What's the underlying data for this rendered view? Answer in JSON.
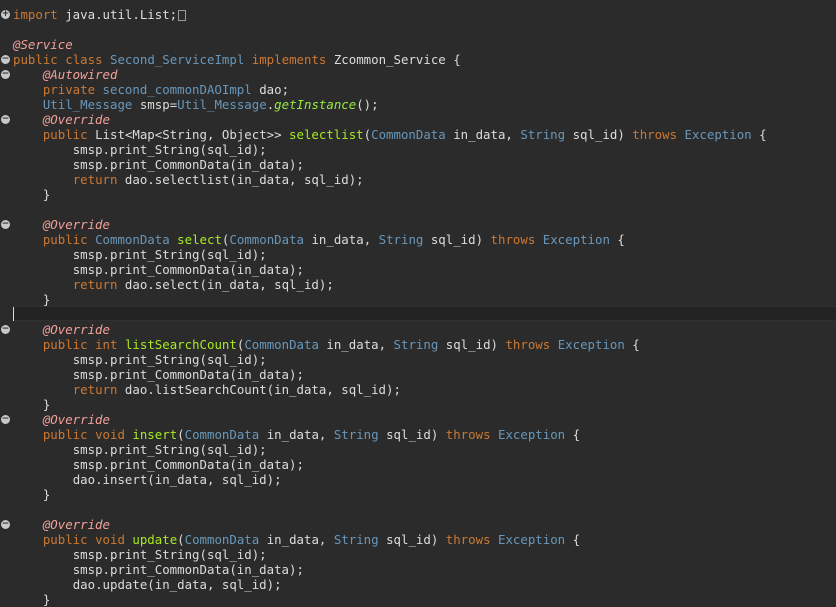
{
  "editor": {
    "language": "java",
    "lines": {
      "l1_import": "import",
      "l1_rest": " java.util.List;",
      "l3": "@Service",
      "l4_public": "public",
      "l4_class": "class",
      "l4_name": "Second_ServiceImpl",
      "l4_implements": "implements",
      "l4_iface": "Zcommon_Service",
      "l4_brace": " {",
      "l5": "@Autowired",
      "l6_private": "private",
      "l6_type": "second_commonDAOImpl",
      "l6_var": "dao;",
      "l7_type": "Util_Message",
      "l7_var": "smsp",
      "l7_eq": "=",
      "l7_cls": "Util_Message",
      "l7_method": "getInstance",
      "l7_end": "();",
      "l8": "@Override",
      "l9_public": "public",
      "l9_ret": "List<Map<String, Object>>",
      "l9_name": "selectlist",
      "l9_p1type": "CommonData",
      "l9_p1": "in_data",
      "l9_p2type": "String",
      "l9_p2": "sql_id",
      "l9_throws": "throws",
      "l9_exc": "Exception",
      "l10": "smsp.print_String(sql_id);",
      "l11": "smsp.print_CommonData(in_data);",
      "l12_return": "return",
      "l12_rest": "dao.selectlist(in_data, sql_id);",
      "close_brace": "}",
      "l15": "@Override",
      "l16_public": "public",
      "l16_ret": "CommonData",
      "l16_name": "select",
      "l16_p1type": "CommonData",
      "l16_p1": "in_data",
      "l16_p2type": "String",
      "l16_p2": "sql_id",
      "l16_throws": "throws",
      "l16_exc": "Exception",
      "l17": "smsp.print_String(sql_id);",
      "l18": "smsp.print_CommonData(in_data);",
      "l19_return": "return",
      "l19_rest": "dao.select(in_data, sql_id);",
      "l22": "@Override",
      "l23_public": "public",
      "l23_int": "int",
      "l23_name": "listSearchCount",
      "l23_p1type": "CommonData",
      "l23_p1": "in_data",
      "l23_p2type": "String",
      "l23_p2": "sql_id",
      "l23_throws": "throws",
      "l23_exc": "Exception",
      "l24": "smsp.print_String(sql_id);",
      "l25": "smsp.print_CommonData(in_data);",
      "l26_return": "return",
      "l26_rest": "dao.listSearchCount(in_data, sql_id);",
      "l28": "@Override",
      "l29_public": "public",
      "l29_void": "void",
      "l29_name": "insert",
      "l29_p1type": "CommonData",
      "l29_p1": "in_data",
      "l29_p2type": "String",
      "l29_p2": "sql_id",
      "l29_throws": "throws",
      "l29_exc": "Exception",
      "l30": "smsp.print_String(sql_id);",
      "l31": "smsp.print_CommonData(in_data);",
      "l32": "dao.insert(in_data, sql_id);",
      "l35": "@Override",
      "l36_public": "public",
      "l36_void": "void",
      "l36_name": "update",
      "l36_p1type": "CommonData",
      "l36_p1": "in_data",
      "l36_p2type": "String",
      "l36_p2": "sql_id",
      "l36_throws": "throws",
      "l36_exc": "Exception",
      "l37": "smsp.print_String(sql_id);",
      "l38": "smsp.print_CommonData(in_data);",
      "l39": "dao.update(in_data, sql_id);"
    }
  },
  "colors": {
    "background": "#2b2b2b",
    "keyword": "#cc7832",
    "annotation": "#f4a09a",
    "type": "#6897bb",
    "method": "#a7ec21",
    "plain": "#dcdcdc"
  },
  "icons": [
    "fold-expand-icon",
    "fold-collapse-icon",
    "collapsed-imports-box-icon"
  ]
}
